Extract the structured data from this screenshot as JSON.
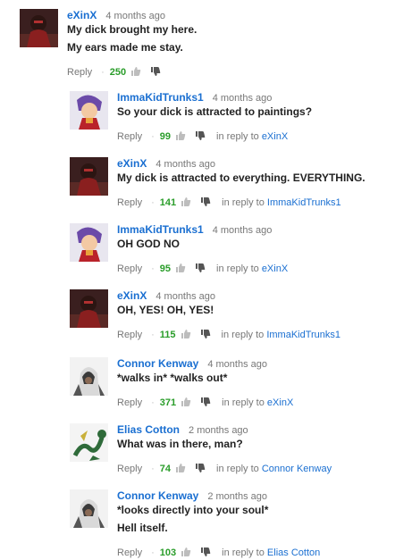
{
  "comments": [
    {
      "author": "eXinX",
      "time": "4 months ago",
      "lines": [
        "My dick brought my here.",
        "My ears made me stay."
      ],
      "reply_label": "Reply",
      "likes": "250",
      "in_reply_label": "",
      "in_reply_to": "",
      "avatar": "exinx-avatar"
    },
    {
      "author": "ImmaKidTrunks1",
      "time": "4 months ago",
      "lines": [
        "So your dick is attracted to paintings?"
      ],
      "reply_label": "Reply",
      "likes": "99",
      "in_reply_label": "in reply to",
      "in_reply_to": "eXinX",
      "avatar": "trunks-avatar"
    },
    {
      "author": "eXinX",
      "time": "4 months ago",
      "lines": [
        "My dick is attracted to everything. EVERYTHING."
      ],
      "reply_label": "Reply",
      "likes": "141",
      "in_reply_label": "in reply to",
      "in_reply_to": "ImmaKidTrunks1",
      "avatar": "exinx-avatar"
    },
    {
      "author": "ImmaKidTrunks1",
      "time": "4 months ago",
      "lines": [
        "OH GOD NO"
      ],
      "reply_label": "Reply",
      "likes": "95",
      "in_reply_label": "in reply to",
      "in_reply_to": "eXinX",
      "avatar": "trunks-avatar"
    },
    {
      "author": "eXinX",
      "time": "4 months ago",
      "lines": [
        "OH, YES! OH, YES!"
      ],
      "reply_label": "Reply",
      "likes": "115",
      "in_reply_label": "in reply to",
      "in_reply_to": "ImmaKidTrunks1",
      "avatar": "exinx-avatar"
    },
    {
      "author": "Connor Kenway",
      "time": "4 months ago",
      "lines": [
        "*walks in* *walks out*"
      ],
      "reply_label": "Reply",
      "likes": "371",
      "in_reply_label": "in reply to",
      "in_reply_to": "eXinX",
      "avatar": "connor-avatar"
    },
    {
      "author": "Elias Cotton",
      "time": "2 months ago",
      "lines": [
        "What was in there, man?"
      ],
      "reply_label": "Reply",
      "likes": "74",
      "in_reply_label": "in reply to",
      "in_reply_to": "Connor Kenway",
      "avatar": "dragon-avatar"
    },
    {
      "author": "Connor Kenway",
      "time": "2 months ago",
      "lines": [
        "*looks directly into your soul*",
        "Hell itself."
      ],
      "reply_label": "Reply",
      "likes": "103",
      "in_reply_label": "in reply to",
      "in_reply_to": "Elias Cotton",
      "avatar": "connor-avatar"
    }
  ],
  "colors": {
    "author": "#1a6fd1",
    "likes": "#2a9d2a",
    "meta": "#777777"
  }
}
